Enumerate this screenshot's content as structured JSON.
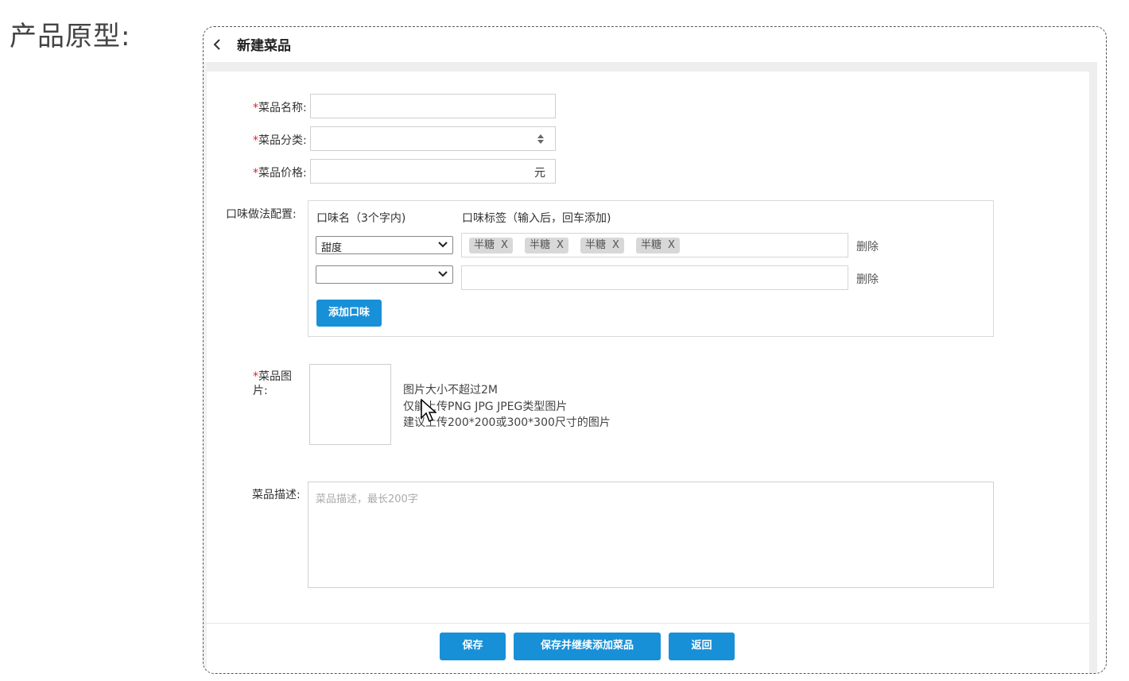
{
  "page": {
    "heading": "产品原型:"
  },
  "header": {
    "title": "新建菜品"
  },
  "form": {
    "required_mark": "*",
    "name_label": "菜品名称:",
    "category_label": "菜品分类:",
    "price_label": "菜品价格:",
    "price_suffix": "元",
    "flavor_label": "口味做法配置:",
    "image_label": "菜品图片:",
    "desc_label": "菜品描述:",
    "desc_placeholder": "菜品描述，最长200字"
  },
  "flavor": {
    "col_name": "口味名（3个字内)",
    "col_tags": "口味标签（输入后，回车添加)",
    "rows": [
      {
        "name": "甜度",
        "tags": [
          "半糖",
          "半糖",
          "半糖",
          "半糖"
        ],
        "delete": "删除"
      },
      {
        "name": "",
        "tags": [],
        "delete": "删除"
      }
    ],
    "tag_close": "X",
    "add_button": "添加口味"
  },
  "upload": {
    "hints": [
      "图片大小不超过2M",
      "仅能上传PNG JPG JPEG类型图片",
      "建议上传200*200或300*300尺寸的图片"
    ]
  },
  "footer": {
    "save": "保存",
    "save_continue": "保存并继续添加菜品",
    "back": "返回"
  },
  "colors": {
    "primary": "#1890d8",
    "required": "#e02020"
  }
}
